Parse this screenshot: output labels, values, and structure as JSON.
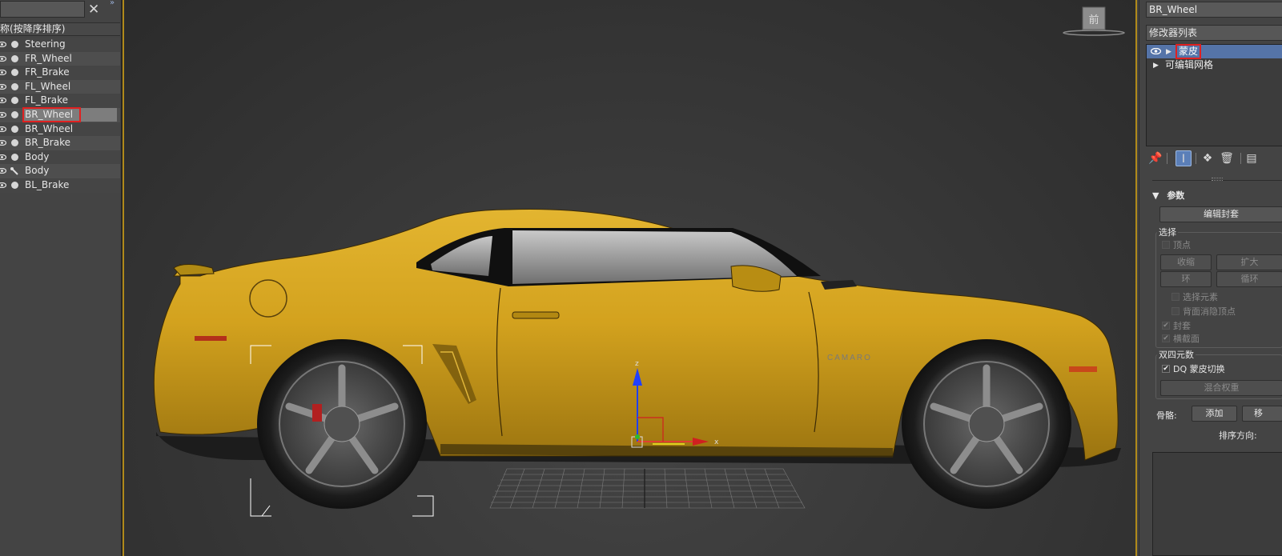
{
  "scene_explorer": {
    "search_value": "",
    "close_icon": "close-icon",
    "column_header": "(按降序排序)",
    "items": [
      {
        "label": "Steering",
        "selected": false
      },
      {
        "label": "FR_Wheel",
        "selected": false
      },
      {
        "label": "FR_Brake",
        "selected": false
      },
      {
        "label": "FL_Wheel",
        "selected": false
      },
      {
        "label": "FL_Brake",
        "selected": false
      },
      {
        "label": "BR_Wheel",
        "selected": true
      },
      {
        "label": "BR_Wheel",
        "selected": false
      },
      {
        "label": "BR_Brake",
        "selected": false
      },
      {
        "label": "Body",
        "selected": false
      },
      {
        "label": "Body",
        "selected": false,
        "icon": "bone-icon"
      },
      {
        "label": "BL_Brake",
        "selected": false
      }
    ]
  },
  "viewport": {
    "viewcube_label": "前",
    "car_color": "#d8a820",
    "gizmo_axes": {
      "z": "z",
      "x": "x"
    },
    "badge_text": "CAMARO"
  },
  "command_panel": {
    "object_name": "BR_Wheel",
    "modifier_list_label": "修改器列表",
    "stack": [
      {
        "label": "蒙皮",
        "selected": true
      },
      {
        "label": "可编辑网格",
        "selected": false
      }
    ],
    "rollout_title": "参数",
    "edit_envelopes_button": "编辑封套",
    "select_group": {
      "title": "选择",
      "vertex_label": "顶点",
      "shrink_button": "收缩",
      "grow_button": "扩大",
      "ring_button": "环",
      "loop_button": "循环",
      "select_element_label": "选择元素",
      "backface_cull_label": "背面消隐顶点",
      "envelopes_label": "封套",
      "cross_sections_label": "横截面"
    },
    "dual_quat_group": {
      "title": "双四元数",
      "dq_toggle_label": "DQ 蒙皮切换",
      "blend_weights_button": "混合权重"
    },
    "bones_label": "骨骼:",
    "add_button": "添加",
    "remove_button_partial": "移",
    "sort_label": "排序方向:"
  }
}
